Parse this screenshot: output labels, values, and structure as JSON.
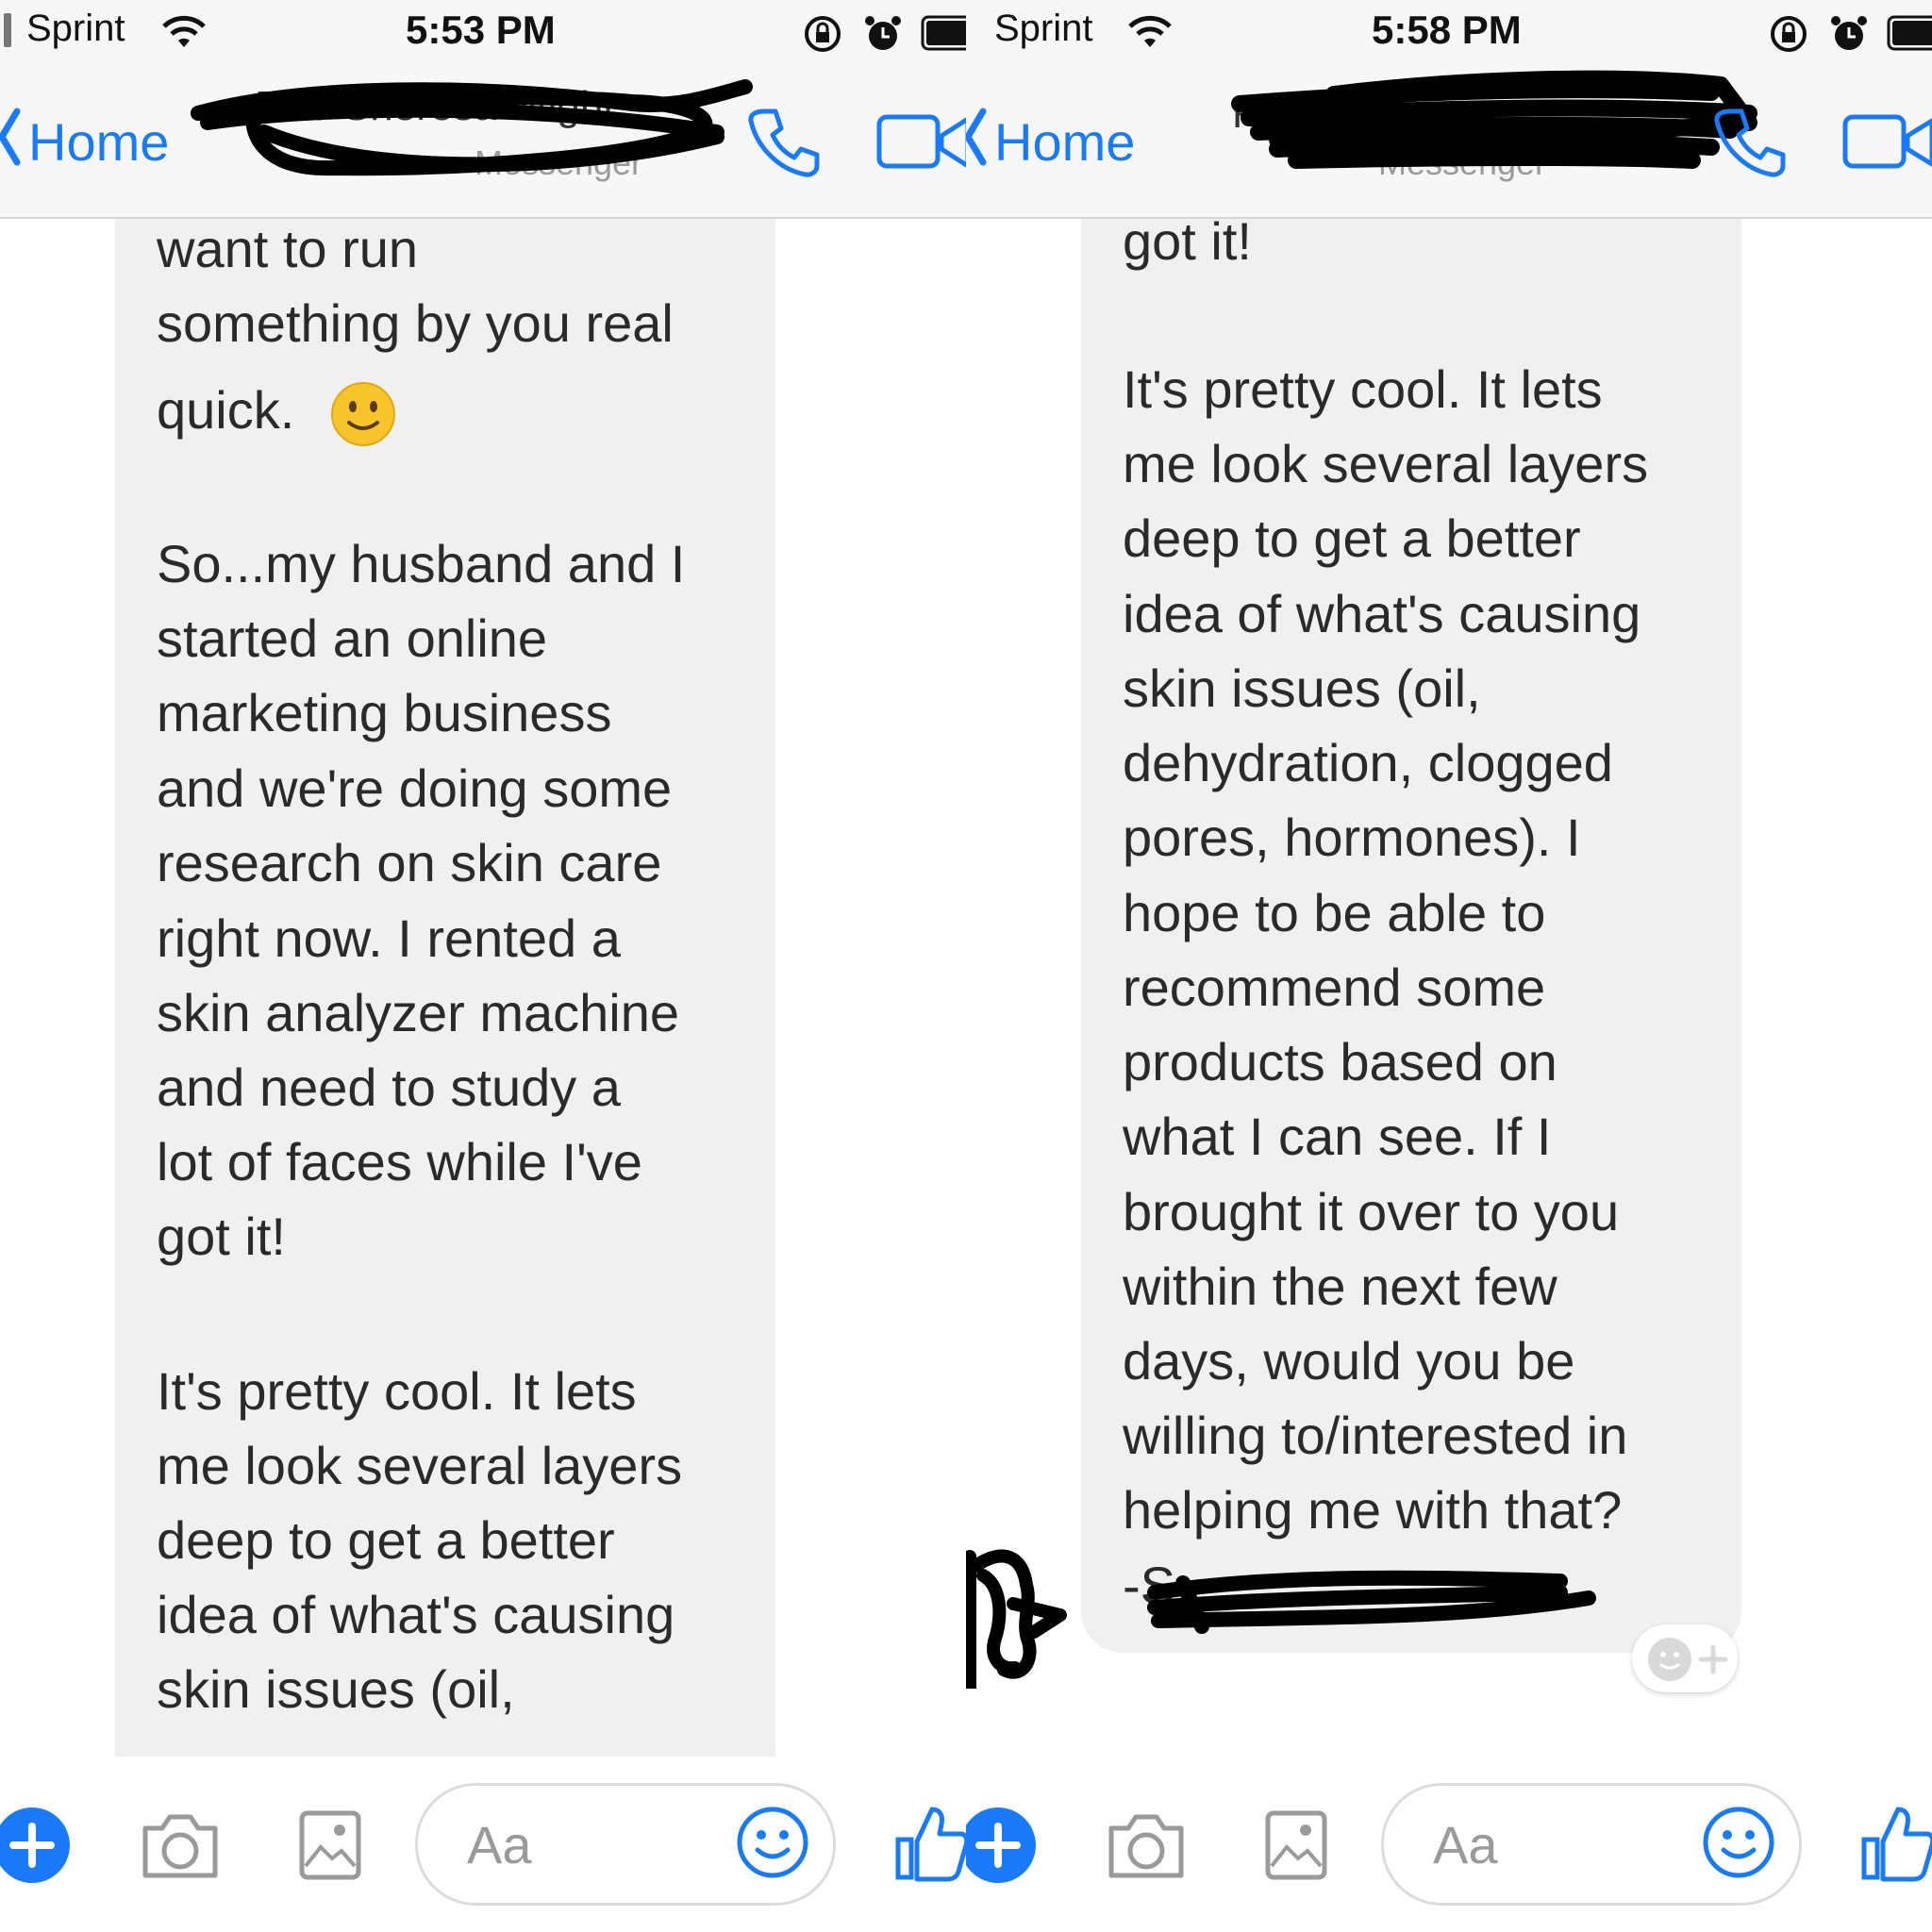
{
  "left": {
    "status": {
      "carrier": "Sprint",
      "time": "5:53 PM"
    },
    "nav": {
      "back": "Home",
      "contact_name": "Roo Sheresa Wight",
      "subtitle": "Messenger"
    },
    "message_lines": [
      "want to run",
      "something by you real",
      "quick.",
      "So...my husband and I",
      "started an online",
      "marketing business",
      "and we're doing some",
      "research on skin care",
      "right now. I rented a",
      "skin analyzer machine",
      "and need to study a",
      "lot of faces while I've",
      "got it!",
      "It's pretty cool. It lets",
      "me look several layers",
      "deep to get a better",
      "idea of what's causing",
      "skin issues (oil,"
    ],
    "composer": {
      "placeholder": "Aa"
    }
  },
  "right": {
    "status": {
      "carrier": "Sprint",
      "time": "5:58 PM"
    },
    "nav": {
      "back": "Home",
      "contact_initial": "R",
      "subtitle": "Messenger"
    },
    "message_lines": [
      "got it!",
      "It's pretty cool. It lets",
      "me look several layers",
      "deep to get a better",
      "idea of what's causing",
      "skin issues (oil,",
      "dehydration, clogged",
      "pores, hormones). I",
      "hope to be able to",
      "recommend some",
      "products based on",
      "what I can see. If I",
      "brought it over to you",
      "within the next few",
      "days, would you be",
      "willing to/interested in",
      "helping me with that?",
      "-S"
    ],
    "composer": {
      "placeholder": "Aa"
    }
  },
  "colors": {
    "accent": "#1a7af8",
    "bubble": "#f0f0f0",
    "redaction": "#000000"
  }
}
